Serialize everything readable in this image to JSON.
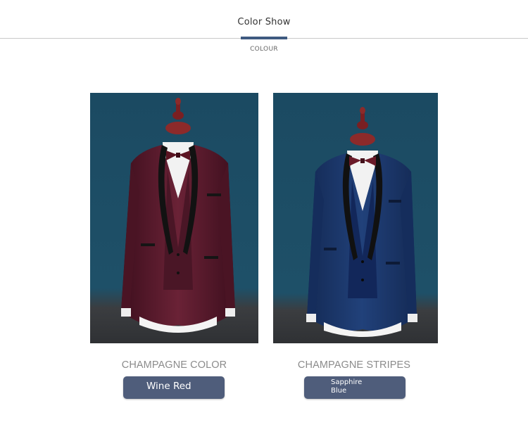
{
  "header": {
    "title": "Color Show",
    "subtitle": "COLOUR",
    "accent_color": "#3f5a80"
  },
  "products": [
    {
      "caption": "CHAMPAGNE COLOR",
      "button_label": "Wine Red",
      "image_name": "wine-red-suit-photo",
      "suit_color": "#5a1a2c",
      "background_color": "#1d4c63"
    },
    {
      "caption": "CHAMPAGNE STRIPES",
      "button_label": "Sapphire Blue",
      "image_name": "sapphire-blue-suit-photo",
      "suit_color": "#1c3566",
      "background_color": "#1d4c63"
    }
  ],
  "button_color": "#4f5d7b"
}
